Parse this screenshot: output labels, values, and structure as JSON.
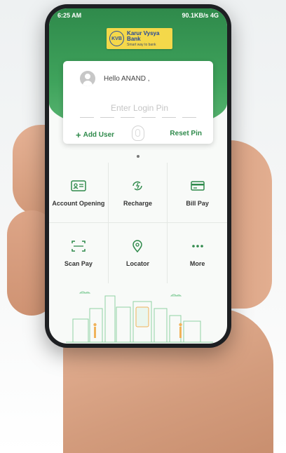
{
  "status_bar": {
    "time": "6:25 AM",
    "network": "90.1KB/s 4G"
  },
  "brand": {
    "mark": "KVB",
    "name": "Karur Vysya Bank",
    "tagline": "Smart way to bank"
  },
  "login": {
    "greeting": "Hello ANAND ,",
    "pin_placeholder": "Enter Login Pin",
    "add_user": "Add User",
    "reset_pin": "Reset Pin"
  },
  "quick_actions": [
    {
      "label": "Account Opening",
      "icon": "id-card-icon"
    },
    {
      "label": "Recharge",
      "icon": "recharge-icon"
    },
    {
      "label": "Bill Pay",
      "icon": "card-icon"
    },
    {
      "label": "Scan Pay",
      "icon": "scan-icon"
    },
    {
      "label": "Locator",
      "icon": "location-pin-icon"
    },
    {
      "label": "More",
      "icon": "more-icon"
    }
  ],
  "colors": {
    "brand_green": "#2f8a4b",
    "brand_yellow": "#f4d84a",
    "brand_blue": "#23469a"
  }
}
